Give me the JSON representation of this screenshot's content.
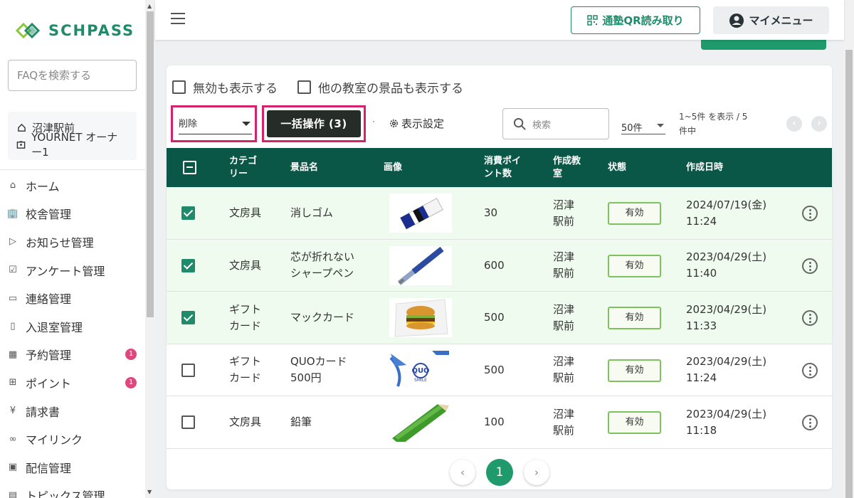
{
  "brand": {
    "name": "SCHPASS",
    "color": "#1f8b6a"
  },
  "sidebar": {
    "faq_placeholder": "FAQを検索する",
    "school": "沼津駅前",
    "user": "YOURNET オーナー1",
    "items": [
      {
        "label": "ホーム",
        "icon": "home-icon"
      },
      {
        "label": "校舎管理",
        "icon": "building-icon"
      },
      {
        "label": "お知らせ管理",
        "icon": "send-icon"
      },
      {
        "label": "アンケート管理",
        "icon": "survey-icon"
      },
      {
        "label": "連絡管理",
        "icon": "chat-icon"
      },
      {
        "label": "入退室管理",
        "icon": "door-icon"
      },
      {
        "label": "予約管理",
        "icon": "calendar-icon",
        "badge": "1"
      },
      {
        "label": "ポイント",
        "icon": "gift-icon",
        "badge": "1"
      },
      {
        "label": "請求書",
        "icon": "yen-icon"
      },
      {
        "label": "マイリンク",
        "icon": "link-icon"
      },
      {
        "label": "配信管理",
        "icon": "broadcast-icon"
      },
      {
        "label": "トピックス管理",
        "icon": "topics-icon"
      }
    ]
  },
  "topbar": {
    "qr_label": "通塾QR読み取り",
    "menu_label": "マイメニュー"
  },
  "filters": {
    "show_disabled": "無効も表示する",
    "show_other_rooms": "他の教室の景品も表示する"
  },
  "toolbar": {
    "action_value": "削除",
    "bulk_label": "一括操作 (3)",
    "display_settings": "表示設定",
    "search_placeholder": "検索",
    "per_page": "50件",
    "range_line1": "1~5件 を表示 / 5",
    "range_line2": "件中"
  },
  "table": {
    "headers": {
      "category": "カテゴリー",
      "name": "景品名",
      "image": "画像",
      "points": "消費ポイント数",
      "room": "作成教室",
      "status": "状態",
      "created": "作成日時"
    },
    "rows": [
      {
        "checked": true,
        "category": "文房具",
        "name": "消しゴム",
        "image": "eraser",
        "points": "30",
        "room": "沼津駅前",
        "status": "有効",
        "date": "2024/07/19(金)",
        "time": "11:24"
      },
      {
        "checked": true,
        "category": "文房具",
        "name": "芯が折れないシャープペン",
        "image": "pen",
        "points": "600",
        "room": "沼津駅前",
        "status": "有効",
        "date": "2023/04/29(土)",
        "time": "11:40"
      },
      {
        "checked": true,
        "category": "ギフトカード",
        "name": "マックカード",
        "image": "burger",
        "points": "500",
        "room": "沼津駅前",
        "status": "有効",
        "date": "2023/04/29(土)",
        "time": "11:33"
      },
      {
        "checked": false,
        "category": "ギフトカード",
        "name": "QUOカード500円",
        "image": "quo",
        "points": "500",
        "room": "沼津駅前",
        "status": "有効",
        "date": "2023/04/29(土)",
        "time": "11:24"
      },
      {
        "checked": false,
        "category": "文房具",
        "name": "鉛筆",
        "image": "pencil",
        "points": "100",
        "room": "沼津駅前",
        "status": "有効",
        "date": "2023/04/29(土)",
        "time": "11:18"
      }
    ]
  },
  "pagination": {
    "prev": "‹",
    "current": "1",
    "next": "›"
  },
  "colors": {
    "table_header": "#0b5747",
    "selected_row": "#eefbee",
    "highlight_border": "#d6226a",
    "badge": "#e0457b"
  }
}
